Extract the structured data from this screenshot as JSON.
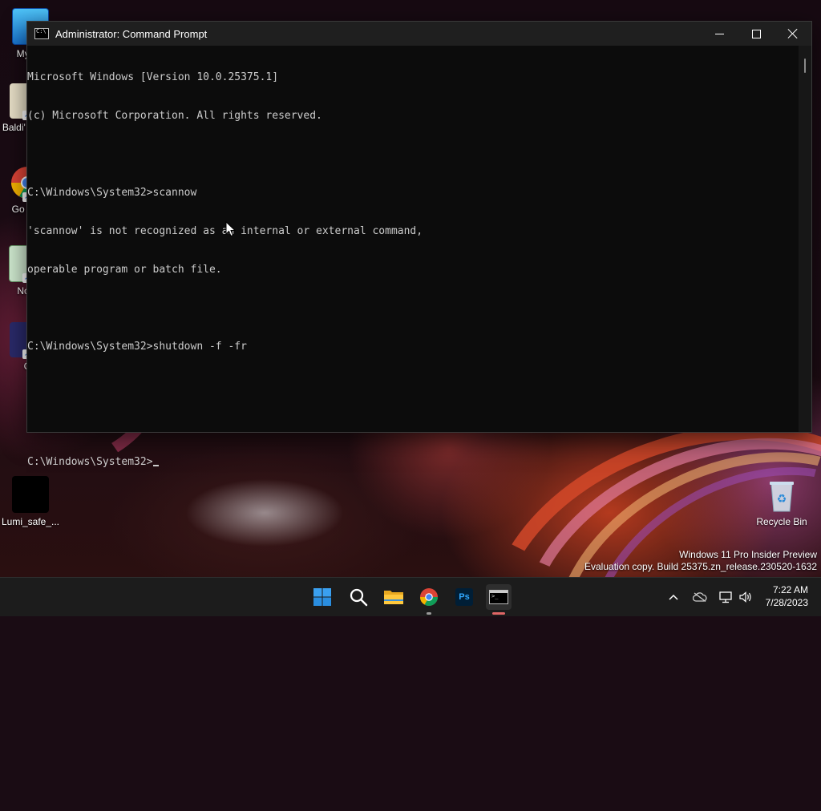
{
  "desktop": {
    "icons": [
      {
        "label": "My Co",
        "icon": "computer-icon"
      },
      {
        "label": "Baldi' Class",
        "icon": "baldi-game-icon"
      },
      {
        "label": "Go Chr",
        "icon": "chrome-icon"
      },
      {
        "label": "Note",
        "icon": "notepad-icon"
      },
      {
        "label": "C",
        "icon": "app-icon"
      },
      {
        "label": "Lumi_safe_...",
        "icon": "black-file-icon"
      },
      {
        "label": "Recycle Bin",
        "icon": "recycle-bin-icon"
      }
    ],
    "watermark": {
      "line1": "Windows 11 Pro Insider Preview",
      "line2": "Evaluation copy. Build 25375.zn_release.230520-1632"
    }
  },
  "cmd": {
    "title": "Administrator: Command Prompt",
    "lines": [
      "Microsoft Windows [Version 10.0.25375.1]",
      "(c) Microsoft Corporation. All rights reserved.",
      "",
      "C:\\Windows\\System32>scannow",
      "'scannow' is not recognized as an internal or external command,",
      "operable program or batch file.",
      "",
      "C:\\Windows\\System32>shutdown -f -fr",
      "",
      ""
    ],
    "prompt": "C:\\Windows\\System32>"
  },
  "taskbar": {
    "apps": [
      {
        "name": "Start",
        "icon": "windows-start-icon"
      },
      {
        "name": "Search",
        "icon": "search-icon"
      },
      {
        "name": "File Explorer",
        "icon": "folder-icon"
      },
      {
        "name": "Google Chrome",
        "icon": "chrome-icon"
      },
      {
        "name": "Photoshop",
        "icon": "photoshop-icon",
        "text": "Ps"
      },
      {
        "name": "Command Prompt",
        "icon": "terminal-icon"
      }
    ],
    "clock": {
      "time": "7:22 AM",
      "date": "7/28/2023"
    }
  },
  "colors": {
    "console_bg": "#0c0c0c",
    "console_text": "#cccccc",
    "titlebar": "#1f1f1f",
    "taskbar": "#1c1c1c",
    "active_indicator": "#e06666"
  }
}
